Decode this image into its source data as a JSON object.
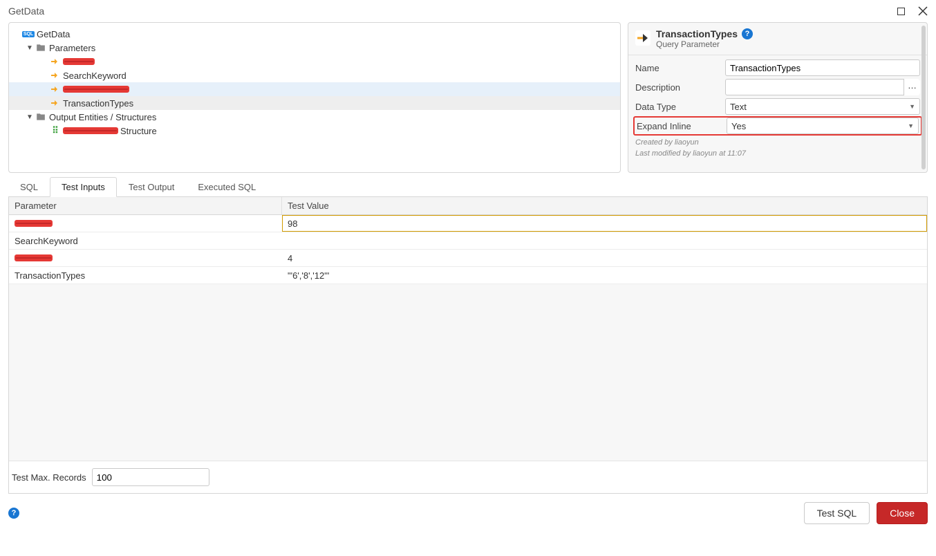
{
  "window": {
    "title": "GetData"
  },
  "tree": {
    "root_label": "GetData",
    "parameters_label": "Parameters",
    "param_redacted_1": "",
    "param_search_keyword": "SearchKeyword",
    "param_redacted_2": "",
    "param_transaction_types": "TransactionTypes",
    "output_label": "Output Entities / Structures",
    "output_structure_suffix": "Structure"
  },
  "props": {
    "title": "TransactionTypes",
    "subtitle": "Query Parameter",
    "name_label": "Name",
    "name_value": "TransactionTypes",
    "description_label": "Description",
    "description_value": "",
    "datatype_label": "Data Type",
    "datatype_value": "Text",
    "expand_label": "Expand Inline",
    "expand_value": "Yes",
    "created_line": "Created by liaoyun",
    "modified_line": "Last modified by liaoyun at 11:07"
  },
  "tabs": {
    "sql": "SQL",
    "test_inputs": "Test Inputs",
    "test_output": "Test Output",
    "executed_sql": "Executed SQL"
  },
  "grid": {
    "header_param": "Parameter",
    "header_value": "Test Value",
    "rows": [
      {
        "redacted": true,
        "value": "98",
        "editing": true
      },
      {
        "name": "SearchKeyword",
        "value": ""
      },
      {
        "redacted": true,
        "value": "4"
      },
      {
        "name": "TransactionTypes",
        "value": "\"'6','8','12'\""
      }
    ]
  },
  "footer": {
    "records_label": "Test Max. Records",
    "records_value": "100",
    "test_sql": "Test SQL",
    "close": "Close"
  }
}
